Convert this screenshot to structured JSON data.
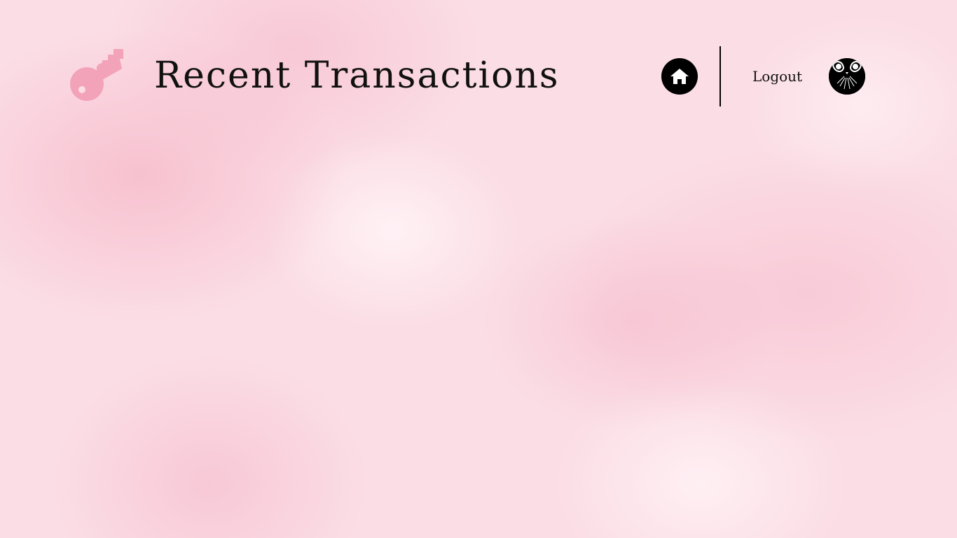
{
  "header": {
    "title": "Recent Transactions",
    "logo_icon": "key-icon",
    "logo_color": "#f2a2b9",
    "nav": {
      "home_icon": "home-icon",
      "logout_label": "Logout",
      "avatar_icon": "cat-face-icon"
    }
  },
  "colors": {
    "background": "#fbdde5",
    "text": "#111111",
    "accent": "#f2a2b9"
  }
}
